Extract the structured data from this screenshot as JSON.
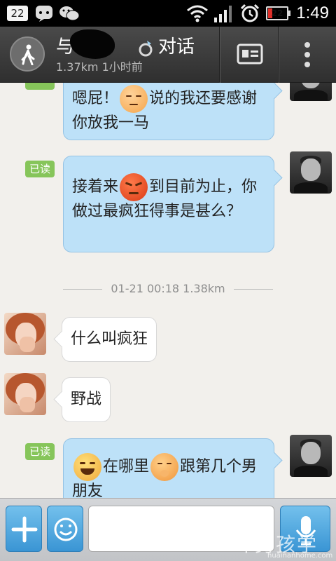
{
  "status_bar": {
    "notification_count": "22",
    "battery_level": "22",
    "battery_fraction": 0.22,
    "time": "1:49",
    "icons": [
      "message-icon",
      "wechat-icon",
      "wifi-icon",
      "signal-icon",
      "alarm-icon",
      "battery-icon"
    ]
  },
  "header": {
    "name_prefix": "与",
    "name_suffix": "对话",
    "subtitle": "1.37km 1小时前",
    "icons": [
      "walk-icon",
      "ring-icon",
      "profile-card-icon",
      "more-icon"
    ]
  },
  "messages": {
    "m1": {
      "text_a": "嗯屁！",
      "emoji": "smug-emoji",
      "text_b": "说的我还要感谢你放我一马"
    },
    "m2": {
      "badge": "已读",
      "text_a": "接着来",
      "emoji": "angry-emoji",
      "text_b": "到目前为止，你做过最疯狂得事是甚么？"
    },
    "divider": "01-21 00:18   1.38km",
    "m3": {
      "text": "什么叫疯狂"
    },
    "m4": {
      "text": "野战"
    },
    "m5": {
      "badge": "已读",
      "emoji_a": "laugh-emoji",
      "text_a": "在哪里",
      "emoji_b": "shy-emoji",
      "text_b": "跟第几个男朋友"
    }
  },
  "input_bar": {
    "add_label": "+",
    "input_value": "",
    "icons": [
      "plus-icon",
      "smiley-icon",
      "microphone-icon"
    ]
  },
  "watermark": {
    "main": "坏男孩学院",
    "sub": "huainanhome.com"
  },
  "colors": {
    "outgoing_bubble": "#bde1f8",
    "incoming_bubble": "#ffffff",
    "read_badge": "#86c55a",
    "input_button": "#3a95d4"
  }
}
